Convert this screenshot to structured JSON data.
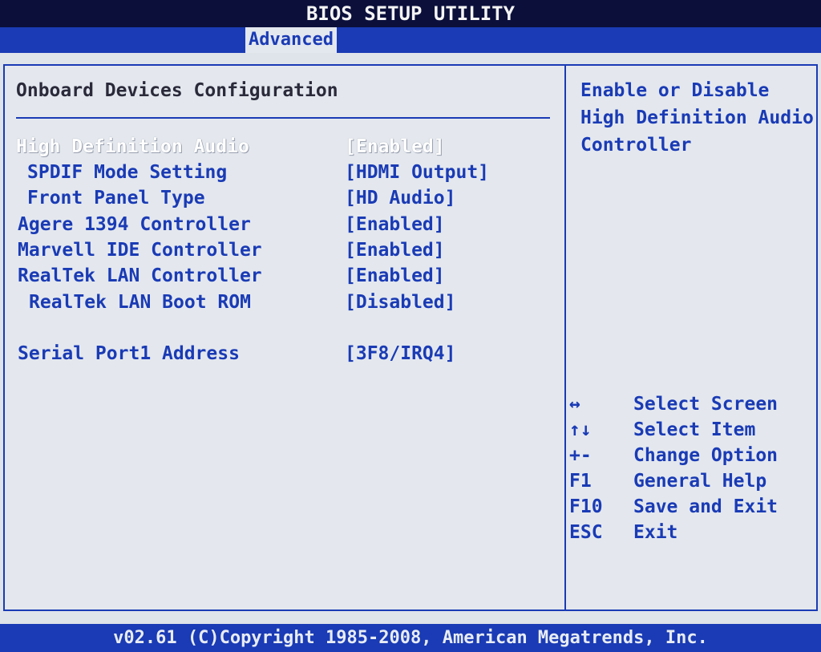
{
  "window": {
    "title": "BIOS SETUP UTILITY"
  },
  "tabs": {
    "active": "Advanced"
  },
  "main": {
    "section_title": "Onboard Devices Configuration",
    "options": [
      {
        "label": "High Definition Audio",
        "value": "[Enabled]",
        "selected": true
      },
      {
        "label": "SPDIF Mode Setting",
        "value": "[HDMI Output]"
      },
      {
        "label": "Front Panel Type",
        "value": "[HD Audio]"
      },
      {
        "label": "Agere 1394 Controller",
        "value": "[Enabled]"
      },
      {
        "label": "Marvell IDE Controller",
        "value": "[Enabled]"
      },
      {
        "label": "RealTek LAN Controller",
        "value": "[Enabled]"
      },
      {
        "label": "RealTek LAN Boot ROM",
        "value": "[Disabled]"
      },
      {
        "label": "Serial Port1 Address",
        "value": "[3F8/IRQ4]"
      }
    ]
  },
  "help": {
    "lines": [
      "Enable or Disable",
      "High Definition Audio",
      "Controller"
    ]
  },
  "keys": [
    {
      "key": "↔",
      "desc": "Select Screen"
    },
    {
      "key": "↑↓",
      "desc": "Select Item"
    },
    {
      "key": "+-",
      "desc": "Change Option"
    },
    {
      "key": "F1",
      "desc": "General Help"
    },
    {
      "key": "F10",
      "desc": "Save and Exit"
    },
    {
      "key": "ESC",
      "desc": "Exit"
    }
  ],
  "footer": {
    "text": "v02.61 (C)Copyright 1985-2008, American Megatrends, Inc."
  },
  "colors": {
    "accent_blue": "#1a3bb5",
    "title_bg": "#0b0f3a",
    "panel_bg": "#e4e8ee",
    "selected_text": "#ffffff"
  }
}
